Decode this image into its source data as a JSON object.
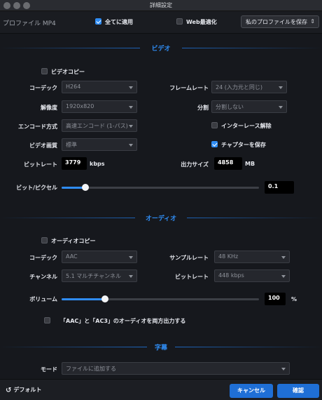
{
  "window": {
    "title": "詳細設定"
  },
  "top": {
    "profile_name": "プロファイル MP4",
    "apply_all_label": "全てに適用",
    "apply_all_checked": true,
    "web_opt_label": "Web最適化",
    "web_opt_checked": false,
    "save_profile_label": "私のプロファイルを保存"
  },
  "video": {
    "section_title": "ビデオ",
    "video_copy_label": "ビデオコピー",
    "video_copy_checked": false,
    "codec_label": "コーデック",
    "codec_value": "H264",
    "framerate_label": "フレームレート",
    "framerate_value": "24 (入力元と同じ)",
    "resolution_label": "解像度",
    "resolution_value": "1920x820",
    "split_label": "分割",
    "split_value": "分割しない",
    "encode_label": "エンコード方式",
    "encode_value": "高速エンコード (1-パス)",
    "deinterlace_label": "インターレース解除",
    "deinterlace_checked": false,
    "quality_label": "ビデオ画質",
    "quality_value": "標準",
    "chapter_label": "チャプターを保存",
    "chapter_checked": true,
    "bitrate_label": "ビットレート",
    "bitrate_value": "3779",
    "bitrate_unit": "kbps",
    "output_size_label": "出力サイズ",
    "output_size_value": "4858",
    "output_size_unit": "MB",
    "bpp_label": "ビット/ピクセル",
    "bpp_value": "0.1",
    "bpp_fraction": 0.12
  },
  "audio": {
    "section_title": "オーディオ",
    "audio_copy_label": "オーディオコピー",
    "audio_copy_checked": false,
    "codec_label": "コーデック",
    "codec_value": "AAC",
    "samplerate_label": "サンプルレート",
    "samplerate_value": "48 KHz",
    "channel_label": "チャンネル",
    "channel_value": "5.1 マルチチャンネル",
    "bitrate_label": "ビットレート",
    "bitrate_value": "448 kbps",
    "volume_label": "ボリューム",
    "volume_value": "100",
    "volume_unit": "%",
    "volume_fraction": 0.22,
    "dual_output_label": "「AAC」と「AC3」のオーディオを両方出力する",
    "dual_output_checked": false
  },
  "subtitle": {
    "section_title": "字幕",
    "mode_label": "モード",
    "mode_value": "ファイルに追加する"
  },
  "footer": {
    "default_label": "デフォルト",
    "cancel_label": "キャンセル",
    "ok_label": "確認"
  },
  "colors": {
    "accent": "#2f8cf3",
    "background": "#16181d",
    "button": "#1f6fd6"
  }
}
